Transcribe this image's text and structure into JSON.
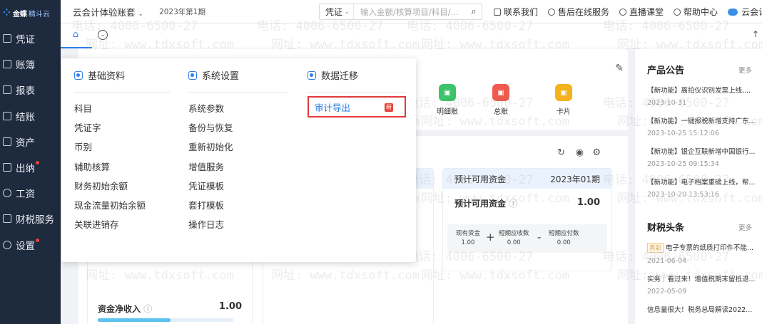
{
  "brand": {
    "name_a": "金蝶",
    "name_b": "精斗云"
  },
  "sidebar": {
    "items": [
      {
        "label": "凭证",
        "icon": "voucher-icon",
        "dot": false
      },
      {
        "label": "账簿",
        "icon": "ledger-icon",
        "dot": false
      },
      {
        "label": "报表",
        "icon": "report-icon",
        "dot": false
      },
      {
        "label": "结账",
        "icon": "closing-icon",
        "dot": false
      },
      {
        "label": "资产",
        "icon": "asset-icon",
        "dot": false
      },
      {
        "label": "出纳",
        "icon": "cashier-icon",
        "dot": true
      },
      {
        "label": "工资",
        "icon": "salary-icon",
        "dot": false
      },
      {
        "label": "财税服务",
        "icon": "tax-service-icon",
        "dot": false
      },
      {
        "label": "设置",
        "icon": "settings-icon",
        "dot": true
      }
    ]
  },
  "header": {
    "account": "云会计体验账套",
    "period": "2023年第1期",
    "search": {
      "type": "凭证",
      "placeholder": "输入金额/核算项目/科目/..."
    },
    "links": [
      "联系我们",
      "售后在线服务",
      "直播课堂",
      "帮助中心",
      "云会计"
    ]
  },
  "quick": [
    {
      "label": "明细账",
      "color": "#3cc46a"
    },
    {
      "label": "总账",
      "color": "#ef5b4f"
    },
    {
      "label": "卡片",
      "color": "#f5b21f"
    }
  ],
  "fund_card": {
    "title": "预计可用资金",
    "date": "2023年01期",
    "main_label": "预计可用资金",
    "main_value": "1.00",
    "parts": [
      {
        "label": "现有资金",
        "value": "1.00"
      },
      {
        "label": "短期应收数",
        "value": "0.00"
      },
      {
        "label": "短期应付数",
        "value": "0.00"
      }
    ],
    "op_plus": "+",
    "op_minus": "-"
  },
  "net_income": {
    "label": "资金净收入",
    "value": "1.00",
    "dash": "--"
  },
  "announcements": {
    "title": "产品公告",
    "more": "更多",
    "items": [
      {
        "text": "【新功能】离拍仪识别发票上线,...",
        "date": "2023-10-31"
      },
      {
        "text": "【新功能】一键报税新增支持广东...",
        "date": "2023-10-25 15:12:06"
      },
      {
        "text": "【新功能】银企互联新增中国银行...",
        "date": "2023-10-25 09:15:34"
      },
      {
        "text": "【新功能】电子档案重磅上线，帮...",
        "date": "2023-10-20 13:53:16"
      }
    ]
  },
  "headlines": {
    "title": "财税头条",
    "more": "更多",
    "items": [
      {
        "tag": "真彩",
        "text": "电子专票的纸质打印件不能...",
        "date": "2021-06-04"
      },
      {
        "tag": "",
        "text": "实务｜看过来！增值税期末留抵退...",
        "date": "2022-05-09"
      },
      {
        "tag": "",
        "text": "信息量很大！税务总局解读2022...",
        "date": ""
      }
    ]
  },
  "menu": {
    "basic": {
      "title": "基础资料",
      "items": [
        "科目",
        "凭证字",
        "币别",
        "辅助核算",
        "财务初始余额",
        "现金流量初始余额",
        "关联进销存"
      ]
    },
    "system": {
      "title": "系统设置",
      "items": [
        "系统参数",
        "备份与恢复",
        "重新初始化",
        "增值服务",
        "凭证模板",
        "套打模板",
        "操作日志"
      ]
    },
    "migrate": {
      "title": "数据迁移",
      "items": [
        "审计导出"
      ],
      "new_badge": "新"
    }
  },
  "watermark": {
    "phone": "电话: 4006-6500-27",
    "site": "网址: www.tdxsoft.com"
  }
}
